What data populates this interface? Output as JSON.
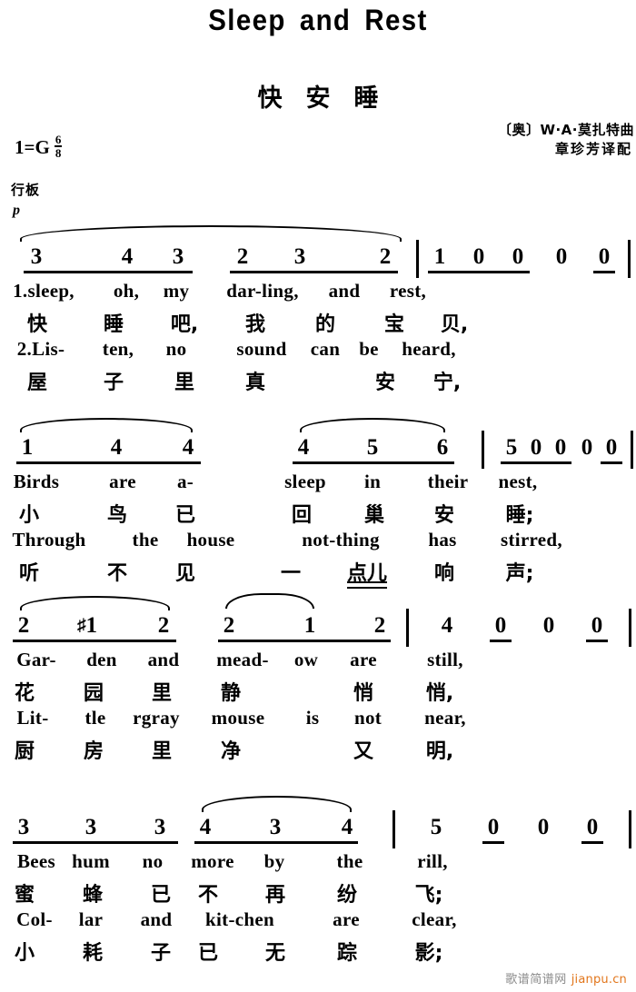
{
  "title": "Sleep and Rest",
  "subtitle": "快安睡",
  "key_signature": {
    "tonic_label": "1",
    "equals": "=",
    "key": "G",
    "meter_num": "6",
    "meter_den": "8"
  },
  "tempo_marking": "行板",
  "dynamic_marking": "p",
  "credits": {
    "composer": "〔奥〕W·A·莫扎特曲",
    "translator": "章珍芳译配"
  },
  "watermark": {
    "site_cn": "歌谱简谱网",
    "site_url": "jianpu.cn"
  },
  "systems": [
    {
      "id": "system-1",
      "notes": [
        "3",
        "4",
        "3",
        "2",
        "3",
        "2",
        "1",
        "0",
        "0",
        "0",
        "0"
      ],
      "lyrics": [
        {
          "lang": "en",
          "verse": "1",
          "syllables": [
            "1.sleep,",
            "oh,",
            "my",
            "dar-ling,",
            "and",
            "rest,"
          ]
        },
        {
          "lang": "cn",
          "verse": "1",
          "syllables": [
            "快",
            "睡",
            "吧,",
            "我",
            "的",
            "宝",
            "贝,"
          ]
        },
        {
          "lang": "en",
          "verse": "2",
          "syllables": [
            "2.Lis-",
            "ten,",
            "no",
            "sound",
            "can",
            "be",
            "heard,"
          ]
        },
        {
          "lang": "cn",
          "verse": "2",
          "syllables": [
            "屋",
            "子",
            "里",
            "真",
            "安",
            "宁,"
          ]
        }
      ]
    },
    {
      "id": "system-2",
      "notes": [
        "1",
        "4",
        "4",
        "4",
        "5",
        "6",
        "5",
        "0",
        "0",
        "0",
        "0"
      ],
      "lyrics": [
        {
          "lang": "en",
          "verse": "1",
          "syllables": [
            "Birds",
            "are",
            "a-",
            "sleep",
            "in",
            "their",
            "nest,"
          ]
        },
        {
          "lang": "cn",
          "verse": "1",
          "syllables": [
            "小",
            "鸟",
            "已",
            "回",
            "巢",
            "安",
            "睡;"
          ]
        },
        {
          "lang": "en",
          "verse": "2",
          "syllables": [
            "Through",
            "the",
            "house",
            "not-thing",
            "has",
            "stirred,"
          ]
        },
        {
          "lang": "cn",
          "verse": "2",
          "syllables": [
            "听",
            "不",
            "见",
            "一",
            "点儿",
            "响",
            "声;"
          ]
        }
      ]
    },
    {
      "id": "system-3",
      "notes": [
        "2",
        "#1",
        "2",
        "2",
        "1",
        "2",
        "4",
        "0",
        "0",
        "0"
      ],
      "lyrics": [
        {
          "lang": "en",
          "verse": "1",
          "syllables": [
            "Gar-",
            "den",
            "and",
            "mead-",
            "ow",
            "are",
            "still,"
          ]
        },
        {
          "lang": "cn",
          "verse": "1",
          "syllables": [
            "花",
            "园",
            "里",
            "静",
            "悄",
            "悄,"
          ]
        },
        {
          "lang": "en",
          "verse": "2",
          "syllables": [
            "Lit-",
            "tle",
            "rgray",
            "mouse",
            "is",
            "not",
            "near,"
          ]
        },
        {
          "lang": "cn",
          "verse": "2",
          "syllables": [
            "厨",
            "房",
            "里",
            "净",
            "又",
            "明,"
          ]
        }
      ]
    },
    {
      "id": "system-4",
      "notes": [
        "3",
        "3",
        "3",
        "4",
        "3",
        "4",
        "5",
        "0",
        "0",
        "0"
      ],
      "lyrics": [
        {
          "lang": "en",
          "verse": "1",
          "syllables": [
            "Bees",
            "hum",
            "no",
            "more",
            "by",
            "the",
            "rill,"
          ]
        },
        {
          "lang": "cn",
          "verse": "1",
          "syllables": [
            "蜜",
            "蜂",
            "已",
            "不",
            "再",
            "纷",
            "飞;"
          ]
        },
        {
          "lang": "en",
          "verse": "2",
          "syllables": [
            "Col-",
            "lar",
            "and",
            "kit-chen",
            "are",
            "clear,"
          ]
        },
        {
          "lang": "cn",
          "verse": "2",
          "syllables": [
            "小",
            "耗",
            "子",
            "已",
            "无",
            "踪",
            "影;"
          ]
        }
      ]
    }
  ]
}
